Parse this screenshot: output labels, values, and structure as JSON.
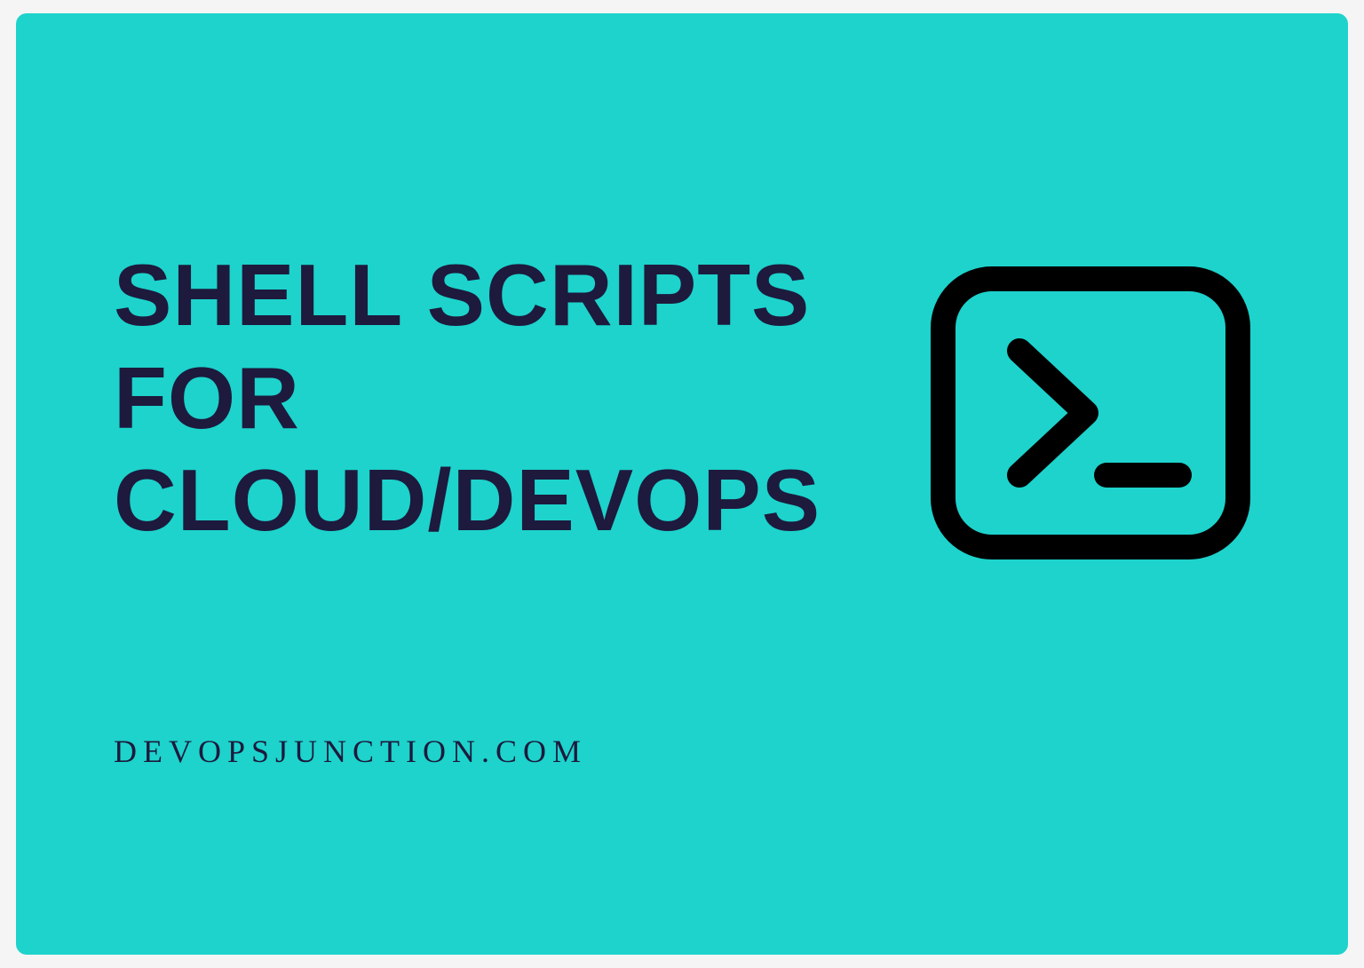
{
  "heading_line1": "SHELL SCRIPTS",
  "heading_line2": "FOR",
  "heading_line3": "CLOUD/DEVOPS",
  "subtext": "DEVOPSJUNCTION.COM",
  "colors": {
    "background": "#1dd3cc",
    "text": "#1d1a3d",
    "icon_stroke": "#000000"
  }
}
